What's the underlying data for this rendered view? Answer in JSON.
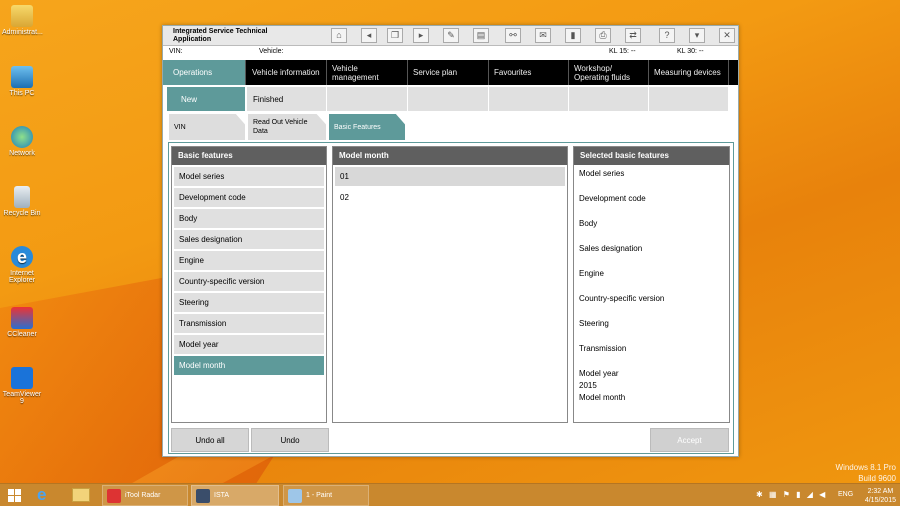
{
  "desktop": {
    "icons": [
      {
        "label": "Administrat..."
      },
      {
        "label": "This PC"
      },
      {
        "label": "Network"
      },
      {
        "label": "Recycle Bin"
      },
      {
        "label": "Internet Explorer"
      },
      {
        "label": "CCleaner"
      },
      {
        "label": "TeamViewer 9"
      }
    ],
    "watermark_line1": "Windows 8.1 Pro",
    "watermark_line2": "Build 9600"
  },
  "app": {
    "title": "Integrated Service Technical Application",
    "vin_label": "VIN:",
    "vehicle_label": "Vehicle:",
    "kl15": "KL 15:  --",
    "kl30": "KL 30:  --",
    "nav_main": [
      {
        "label": "Operations"
      },
      {
        "label": "Vehicle information"
      },
      {
        "label": "Vehicle management"
      },
      {
        "label": "Service plan"
      },
      {
        "label": "Favourites"
      },
      {
        "label": "Workshop/ Operating fluids"
      },
      {
        "label": "Measuring devices"
      }
    ],
    "nav_sub": [
      {
        "label": "New"
      },
      {
        "label": "Finished"
      }
    ],
    "subtabs": [
      {
        "label": "VIN"
      },
      {
        "label": "Read Out Vehicle Data"
      },
      {
        "label": "Basic Features"
      }
    ],
    "basic_features": {
      "title": "Basic features",
      "items": [
        "Model series",
        "Development code",
        "Body",
        "Sales designation",
        "Engine",
        "Country-specific version",
        "Steering",
        "Transmission",
        "Model year",
        "Model month"
      ]
    },
    "model_month": {
      "title": "Model month",
      "items": [
        "01",
        "02"
      ]
    },
    "selected": {
      "title": "Selected basic features",
      "items": [
        "Model series",
        "Development code",
        "Body",
        "Sales designation",
        "Engine",
        "Country-specific version",
        "Steering",
        "Transmission",
        "Model year"
      ],
      "model_year_value": "2015",
      "last_item": "Model month"
    },
    "buttons": {
      "undo_all": "Undo all",
      "undo": "Undo",
      "accept": "Accept"
    }
  },
  "taskbar": {
    "tasks": [
      {
        "label": "iTool Radar"
      },
      {
        "label": "ISTA"
      },
      {
        "label": "1 - Paint"
      }
    ],
    "lang": "ENG",
    "time": "2:32 AM",
    "date": "4/15/2015"
  }
}
